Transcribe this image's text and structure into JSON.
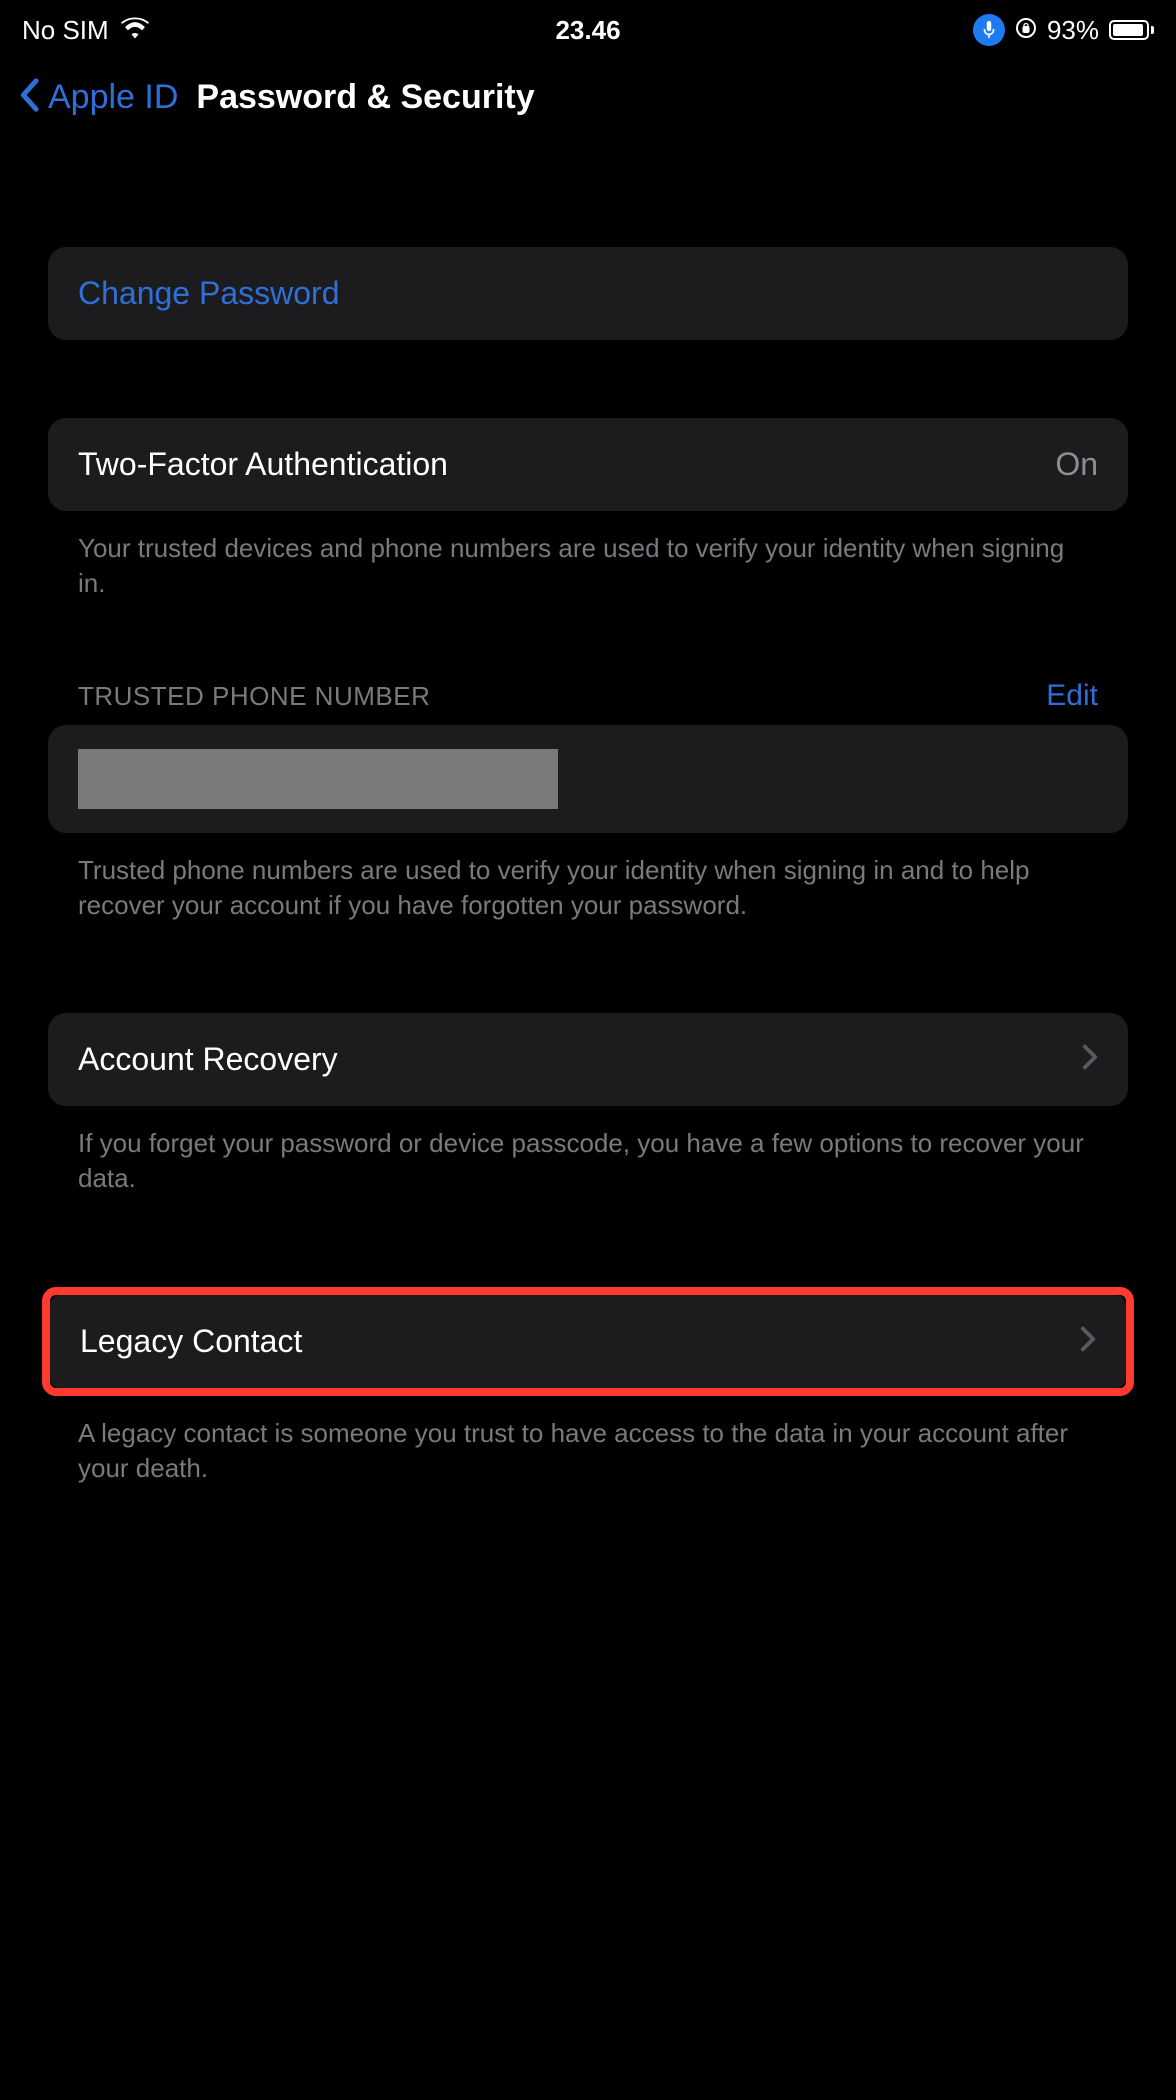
{
  "status": {
    "carrier": "No SIM",
    "time": "23.46",
    "battery_pct": "93%"
  },
  "nav": {
    "back_label": "Apple ID",
    "title": "Password & Security"
  },
  "sections": {
    "change_password": "Change Password",
    "two_factor": {
      "label": "Two-Factor Authentication",
      "value": "On",
      "footer": "Your trusted devices and phone numbers are used to verify your identity when signing in."
    },
    "trusted_phone": {
      "header": "TRUSTED PHONE NUMBER",
      "edit": "Edit",
      "footer": "Trusted phone numbers are used to verify your identity when signing in and to help recover your account if you have forgotten your password."
    },
    "account_recovery": {
      "label": "Account Recovery",
      "footer": "If you forget your password or device passcode, you have a few options to recover your data."
    },
    "legacy_contact": {
      "label": "Legacy Contact",
      "footer": "A legacy contact is someone you trust to have access to the data in your account after your death."
    }
  }
}
